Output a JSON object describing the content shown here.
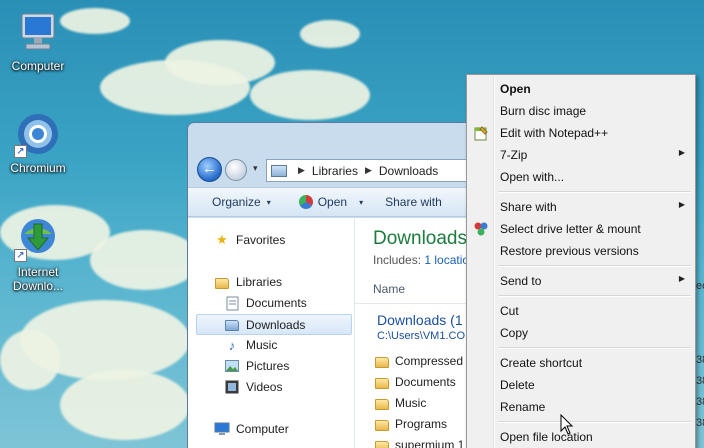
{
  "desktop": {
    "icons": [
      {
        "label": "Computer",
        "icon": "computer-icon"
      },
      {
        "label": "Chromium",
        "icon": "chromium-icon"
      },
      {
        "label": "Internet Downlo...",
        "icon": "internet-download-manager-icon"
      }
    ],
    "shortcut_glyph": "↗"
  },
  "explorer": {
    "nav": {
      "back": "←",
      "dropdown": "▾"
    },
    "address": {
      "crumbs": [
        "Libraries",
        "Downloads"
      ],
      "separator": "▶"
    },
    "toolbar": {
      "organize": "Organize",
      "open": "Open",
      "share_with": "Share with",
      "caret": "▾"
    },
    "nav_pane": {
      "favorites": "Favorites",
      "libraries": "Libraries",
      "documents": "Documents",
      "downloads": "Downloads",
      "music": "Music",
      "pictures": "Pictures",
      "videos": "Videos",
      "computer": "Computer"
    },
    "content": {
      "title": "Downloads",
      "includes_label": "Includes:",
      "includes_link": "1 locatio",
      "column_name": "Name",
      "group_title": "Downloads (1",
      "group_path": "C:\\Users\\VM1.CO",
      "folders": [
        "Compressed",
        "Documents",
        "Music",
        "Programs",
        "supermium 1"
      ]
    }
  },
  "context_menu": {
    "items": [
      {
        "label": "Open",
        "bold": true
      },
      {
        "label": "Burn disc image"
      },
      {
        "label": "Edit with Notepad++",
        "icon": "notepad-plus-plus-icon"
      },
      {
        "label": "7-Zip",
        "submenu": true
      },
      {
        "label": "Open with..."
      },
      {
        "label": "Share with",
        "submenu": true
      },
      {
        "label": "Select drive letter & mount",
        "icon": "drive-mount-icon"
      },
      {
        "label": "Restore previous versions"
      },
      {
        "label": "Send to",
        "submenu": true
      },
      {
        "label": "Cut"
      },
      {
        "label": "Copy"
      },
      {
        "label": "Create shortcut"
      },
      {
        "label": "Delete"
      },
      {
        "label": "Rename"
      },
      {
        "label": "Open file location"
      }
    ],
    "submenu_arrow": "▶"
  },
  "right_edge_fragments": [
    "ec",
    "38",
    "38",
    "38",
    "38"
  ]
}
